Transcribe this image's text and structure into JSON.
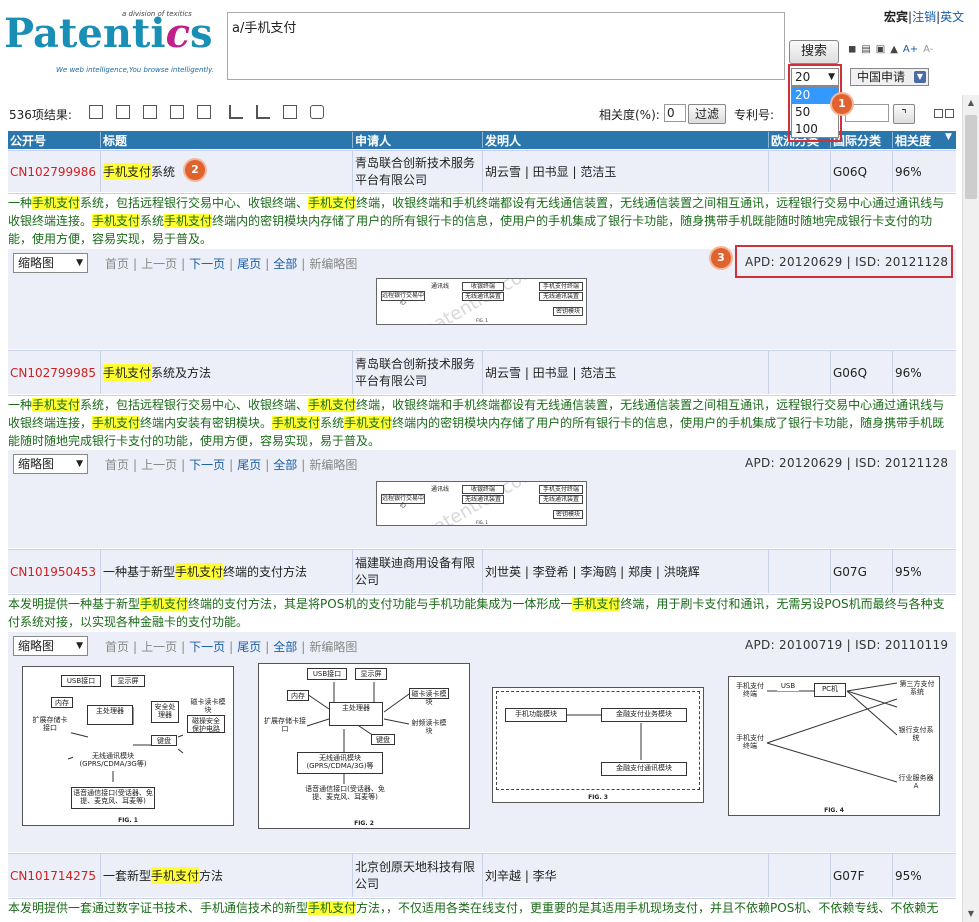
{
  "header": {
    "logo_main": "Patentics",
    "logo_tagline": "We web intelligence,You browse intelligently.",
    "logo_division": "a division of texitics",
    "search_query": "a/手机支付",
    "search_button": "搜索",
    "user": "宏宾",
    "logout": "注销",
    "english": "英文",
    "page_size_value": "20",
    "page_size_options": [
      "20",
      "50",
      "100"
    ],
    "country": "中国申请",
    "font_larger": "A+",
    "font_smaller": "A-"
  },
  "toolbar": {
    "result_count": "536项结果:",
    "relevance_label": "相关度(%):",
    "relevance_value": "0",
    "filter_button": "过滤",
    "patent_no_label": "专利号:"
  },
  "table": {
    "headers": [
      "公开号",
      "标题",
      "申请人",
      "发明人",
      "欧洲分类",
      "国际分类",
      "相关度"
    ],
    "rows": [
      {
        "pub": "CN102799986",
        "title_hl": "手机支付",
        "title_rest": "系统",
        "applicant": "青岛联合创新技术服务平台有限公司",
        "inventors": "胡云雪 | 田书显 | 范洁玉",
        "ipc": "G06Q",
        "relevance": "96%",
        "abstract": [
          {
            "t": "一种"
          },
          {
            "t": "手机支付",
            "h": true
          },
          {
            "t": "系统，包括远程银行交易中心、收银终端、"
          },
          {
            "t": "手机支付",
            "h": true
          },
          {
            "t": "终端，收银终端和手机终端都设有无线通信装置，无线通信装置之间相互通讯，远程银行交易中心通过通讯线与收银终端连接。"
          },
          {
            "t": "手机支付",
            "h": true
          },
          {
            "t": "系统"
          },
          {
            "t": "手机支付",
            "h": true
          },
          {
            "t": "终端内的密钥模块内存储了用户的所有银行卡的信息，使用户的手机集成了银行卡功能，随身携带手机既能随时随地完成银行卡支付的功能，使用方便，容易实现，易于普及。"
          }
        ],
        "view": "缩略图",
        "pager": [
          "首页",
          "上一页",
          "下一页",
          "尾页",
          "全部",
          "新编略图"
        ],
        "dates": "APD: 20120629 | ISD: 20121128"
      },
      {
        "pub": "CN102799985",
        "title_hl": "手机支付",
        "title_rest": "系统及方法",
        "applicant": "青岛联合创新技术服务平台有限公司",
        "inventors": "胡云雪 | 田书显 | 范洁玉",
        "ipc": "G06Q",
        "relevance": "96%",
        "abstract": [
          {
            "t": "一种"
          },
          {
            "t": "手机支付",
            "h": true
          },
          {
            "t": "系统，包括远程银行交易中心、收银终端、"
          },
          {
            "t": "手机支付",
            "h": true
          },
          {
            "t": "终端，收银终端和手机终端都设有无线通信装置，无线通信装置之间相互通讯，远程银行交易中心通过通讯线与收银终端连接，"
          },
          {
            "t": "手机支付",
            "h": true
          },
          {
            "t": "终端内安装有密钥模块。"
          },
          {
            "t": "手机支付",
            "h": true
          },
          {
            "t": "系统"
          },
          {
            "t": "手机支付",
            "h": true
          },
          {
            "t": "终端内的密钥模块内存储了用户的所有银行卡的信息，使用户的手机集成了银行卡功能，随身携带手机既能随时随地完成银行卡支付的功能，使用方便，容易实现，易于普及。"
          }
        ],
        "view": "缩略图",
        "pager": [
          "首页",
          "上一页",
          "下一页",
          "尾页",
          "全部",
          "新编略图"
        ],
        "dates": "APD: 20120629 | ISD: 20121128"
      },
      {
        "pub": "CN101950453",
        "title_pre": "一种基于新型",
        "title_hl": "手机支付",
        "title_rest": "终端的支付方法",
        "applicant": "福建联迪商用设备有限公司",
        "inventors": "刘世英 | 李登希 | 李海鸥 | 郑庚 | 洪晓辉",
        "ipc": "G07G",
        "relevance": "95%",
        "abstract": [
          {
            "t": "本发明提供一种基于新型"
          },
          {
            "t": "手机支付",
            "h": true
          },
          {
            "t": "终端的支付方法，其是将POS机的支付功能与手机功能集成为一体形成一"
          },
          {
            "t": "手机支付",
            "h": true
          },
          {
            "t": "终端，用于刷卡支付和通讯，无需另设POS机而最终与各种支付系统对接，以实现各种金融卡的支付功能。"
          }
        ],
        "view": "缩略图",
        "pager": [
          "首页",
          "上一页",
          "下一页",
          "尾页",
          "全部",
          "新编略图"
        ],
        "dates": "APD: 20100719 | ISD: 20110119"
      },
      {
        "pub": "CN101714275",
        "title_pre": "一套新型",
        "title_hl": "手机支付",
        "title_rest": "方法",
        "applicant": "北京创原天地科技有限公司",
        "inventors": "刘辛越 | 李华",
        "ipc": "G07F",
        "relevance": "95%",
        "abstract": [
          {
            "t": "本发明提供一套通过数字证书技术、手机通信技术的新型"
          },
          {
            "t": "手机支付",
            "h": true
          },
          {
            "t": "方法，，不仅适用各类在线支付，更重要的是其适用手机现场支付，并且不依赖POS机、不依赖专线、不依赖无"
          }
        ]
      }
    ]
  },
  "thumb": {
    "watermark": "patentics.com",
    "b1": "远程银行交易中心",
    "b2": "通讯线",
    "b3": "收银终端",
    "b4": "无线通讯装置",
    "b5": "手机支付终端",
    "b6": "无线通讯装置",
    "b7": "密钥模块",
    "fig1": "FIG. 1"
  },
  "figs": {
    "f1": {
      "usb": "USB接口",
      "disp": "显示屏",
      "mem": "内存",
      "ext": "扩展存储卡接口",
      "cpu": "主处理器",
      "sec": "安全处理器",
      "card": "磁卡读卡模块",
      "safe": "磁操安全保护电路",
      "key": "键盘",
      "wl": "无线通讯模块 (GPRS/CDMA/3G等)",
      "voice": "语音通信接口(受话器、免提、麦克风、耳麦等)",
      "cap": "FIG. 1"
    },
    "f2": {
      "usb": "USB接口",
      "disp": "显示屏",
      "mem": "内存",
      "ext": "扩展存储卡接口",
      "cpu": "主处理器",
      "card": "磁卡读卡模块",
      "rf": "射频读卡模块",
      "key": "键盘",
      "wl": "无线通讯模块 (GPRS/CDMA/3G)等",
      "voice": "语音通信接口(受话器、免提、麦克风、耳麦等)",
      "cap": "FIG. 2"
    },
    "f3": {
      "a": "手机功能模块",
      "b": "金融支付业务模块",
      "c": "金融支付通讯模块",
      "cap": "FIG. 3"
    },
    "f4": {
      "a": "手机支付终端",
      "usb": "USB",
      "pc": "PC机",
      "b": "手机支付终端",
      "c": "第三方支付系统",
      "d": "银行支付系统",
      "e": "行业服务器A",
      "cap": "FIG. 4"
    }
  }
}
